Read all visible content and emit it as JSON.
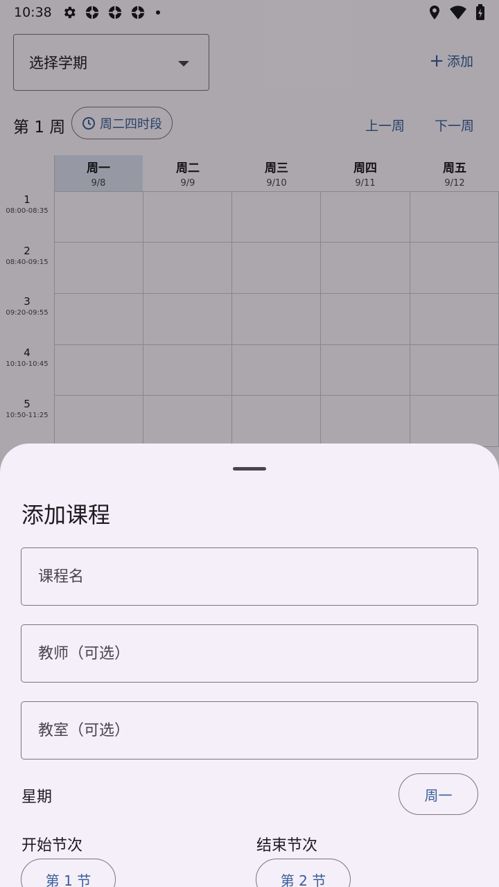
{
  "status_bar": {
    "time": "10:38",
    "icons": [
      "gear-icon",
      "aperture-icon",
      "aperture-icon",
      "aperture-icon",
      "dot-icon"
    ],
    "right_icons": [
      "location-icon",
      "wifi-icon",
      "battery-charging-icon"
    ]
  },
  "header": {
    "semester_select": "选择学期",
    "add_button": "添加"
  },
  "week_nav": {
    "week_prefix": "第",
    "week_number": "1",
    "week_suffix": "周",
    "period_chip": "周二四时段",
    "prev_week": "上一周",
    "next_week": "下一周"
  },
  "days": [
    {
      "name": "周一",
      "date": "9/8"
    },
    {
      "name": "周二",
      "date": "9/9"
    },
    {
      "name": "周三",
      "date": "9/10"
    },
    {
      "name": "周四",
      "date": "9/11"
    },
    {
      "name": "周五",
      "date": "9/12"
    }
  ],
  "slots": [
    {
      "num": "1",
      "time": "08:00-08:35"
    },
    {
      "num": "2",
      "time": "08:40-09:15"
    },
    {
      "num": "3",
      "time": "09:20-09:55"
    },
    {
      "num": "4",
      "time": "10:10-10:45"
    },
    {
      "num": "5",
      "time": "10:50-11:25"
    }
  ],
  "sheet": {
    "title": "添加课程",
    "course_name_placeholder": "课程名",
    "teacher_placeholder": "教师（可选）",
    "room_placeholder": "教室（可选）",
    "weekday_label": "星期",
    "weekday_value": "周一",
    "start_label": "开始节次",
    "start_value": "第 1 节",
    "end_label": "结束节次",
    "end_value": "第 2 节"
  },
  "colors": {
    "accent": "#3a5f9a",
    "sheet_bg": "#f4eff8",
    "outline": "#79747e",
    "today_header": "#dde2f0"
  }
}
